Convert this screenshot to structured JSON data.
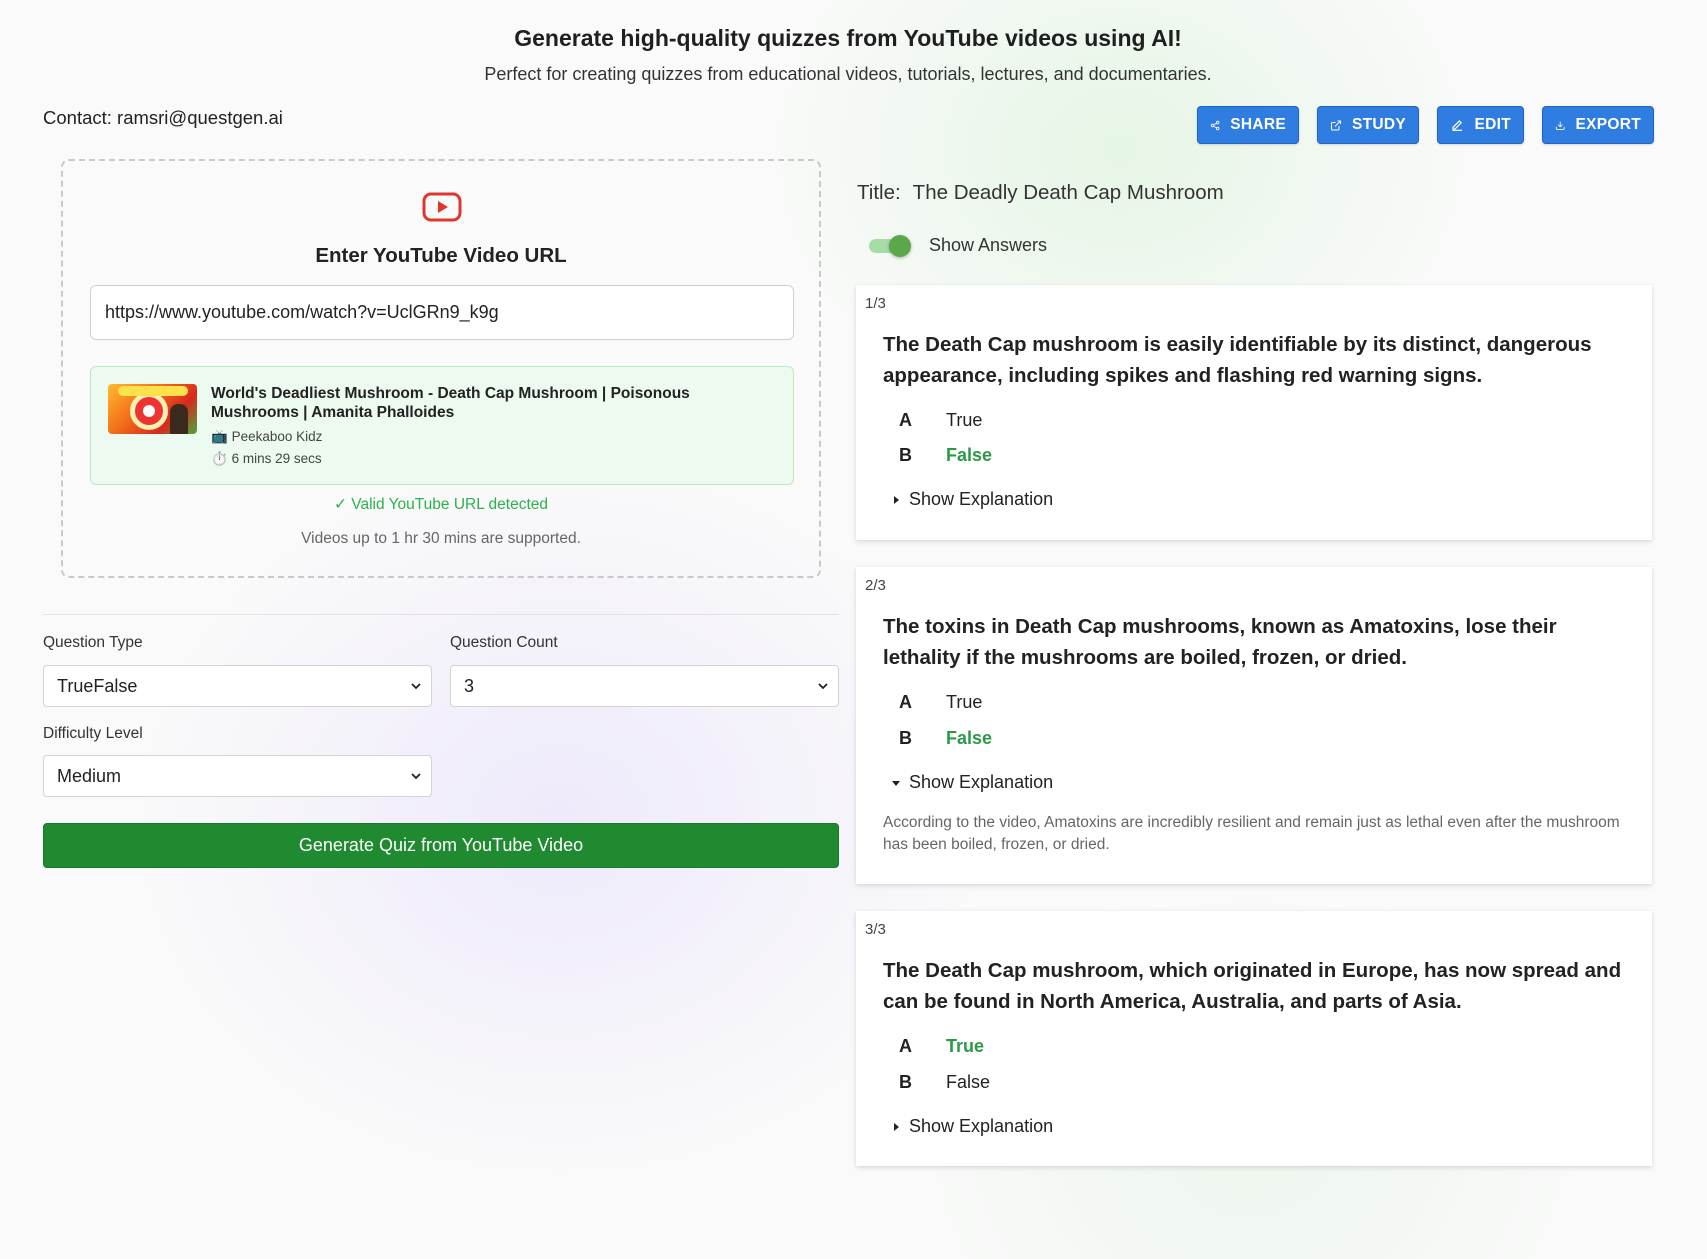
{
  "header": {
    "title": "Generate high-quality quizzes from YouTube videos using AI!",
    "subtitle": "Perfect for creating quizzes from educational videos, tutorials, lectures, and documentaries."
  },
  "contact": "Contact: ramsri@questgen.ai",
  "toolbar": {
    "share": "SHARE",
    "study": "STUDY",
    "edit": "EDIT",
    "export": "EXPORT",
    "color": "#2f7de1"
  },
  "input_panel": {
    "heading": "Enter YouTube Video URL",
    "url_value": "https://www.youtube.com/watch?v=UclGRn9_k9g",
    "video": {
      "title": "World's Deadliest Mushroom - Death Cap Mushroom | Poisonous Mushrooms | Amanita Phalloides",
      "channel": "Peekaboo Kidz",
      "duration": "6 mins 29 secs"
    },
    "valid_message": "✓ Valid YouTube URL detected",
    "support_message": "Videos up to 1 hr 30 mins are supported."
  },
  "settings": {
    "question_type_label": "Question Type",
    "question_type_value": "TrueFalse",
    "question_count_label": "Question Count",
    "question_count_value": "3",
    "difficulty_label": "Difficulty Level",
    "difficulty_value": "Medium",
    "generate_button": "Generate Quiz from YouTube Video",
    "generate_color": "#1f8a2f"
  },
  "quiz": {
    "title_label": "Title:",
    "title": "The Deadly Death Cap Mushroom",
    "show_answers_label": "Show Answers",
    "show_answers_on": true,
    "correct_color": "#2b9a48",
    "questions": [
      {
        "number": "1/3",
        "text": "The Death Cap mushroom is easily identifiable by its distinct, dangerous appearance, including spikes and flashing red warning signs.",
        "options": [
          {
            "letter": "A",
            "text": "True",
            "correct": false
          },
          {
            "letter": "B",
            "text": "False",
            "correct": true
          }
        ],
        "explanation_toggle": "Show Explanation",
        "explanation_expanded": false
      },
      {
        "number": "2/3",
        "text": "The toxins in Death Cap mushrooms, known as Amatoxins, lose their lethality if the mushrooms are boiled, frozen, or dried.",
        "options": [
          {
            "letter": "A",
            "text": "True",
            "correct": false
          },
          {
            "letter": "B",
            "text": "False",
            "correct": true
          }
        ],
        "explanation_toggle": "Show Explanation",
        "explanation_expanded": true,
        "explanation": "According to the video, Amatoxins are incredibly resilient and remain just as lethal even after the mushroom has been boiled, frozen, or dried."
      },
      {
        "number": "3/3",
        "text": "The Death Cap mushroom, which originated in Europe, has now spread and can be found in North America, Australia, and parts of Asia.",
        "options": [
          {
            "letter": "A",
            "text": "True",
            "correct": true
          },
          {
            "letter": "B",
            "text": "False",
            "correct": false
          }
        ],
        "explanation_toggle": "Show Explanation",
        "explanation_expanded": false
      }
    ]
  }
}
